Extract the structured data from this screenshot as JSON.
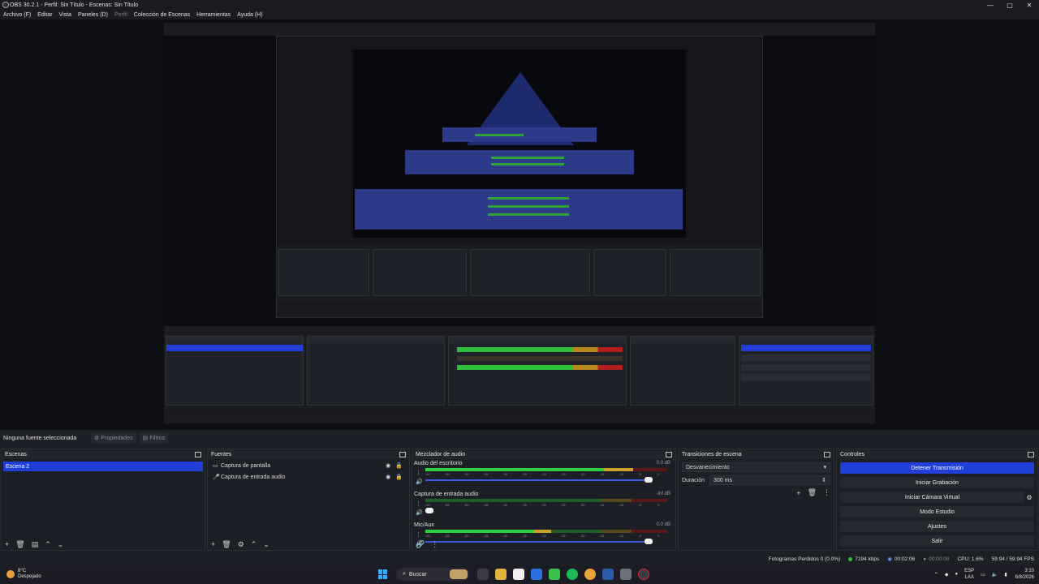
{
  "window": {
    "title": "OBS 30.2.1 - Perfil: Sin Título - Escenas: Sin Título",
    "controls": [
      "—",
      "▢",
      "✕"
    ]
  },
  "menu": {
    "items": [
      {
        "label": "Archivo (F)",
        "enabled": true
      },
      {
        "label": "Editar",
        "enabled": true
      },
      {
        "label": "Vista",
        "enabled": true
      },
      {
        "label": "Paneles (D)",
        "enabled": true
      },
      {
        "label": "Perfil",
        "enabled": false
      },
      {
        "label": "Colección de Escenas",
        "enabled": true
      },
      {
        "label": "Herramientas",
        "enabled": true
      },
      {
        "label": "Ayuda (H)",
        "enabled": true
      }
    ]
  },
  "sourcebar": {
    "no_selection": "Ninguna fuente seleccionada",
    "properties": "Propiedades",
    "filters": "Filtros"
  },
  "scenes": {
    "title": "Escenas",
    "items": [
      "Escena 2"
    ],
    "selected": "Escena 2"
  },
  "sources": {
    "title": "Fuentes",
    "items": [
      {
        "label": "Captura de pantalla",
        "icon": "monitor-icon"
      },
      {
        "label": "Captura de entrada audio",
        "icon": "microphone-icon"
      }
    ]
  },
  "mixer": {
    "title": "Mezclador de audio",
    "channels": [
      {
        "name": "Audio del escritorio",
        "db": "0.0 dB",
        "level": 0.86,
        "volume": 1.0
      },
      {
        "name": "Captura de entrada audio",
        "db": "-inf dB",
        "level": 0.0,
        "volume": 0.0
      },
      {
        "name": "Mic/Aux",
        "db": "0.0 dB",
        "level": 0.52,
        "volume": 1.0
      }
    ],
    "ticks": [
      "-60",
      "-55",
      "-50",
      "-45",
      "-40",
      "-35",
      "-30",
      "-25",
      "-20",
      "-15",
      "-10",
      "-5",
      "0"
    ]
  },
  "transitions": {
    "title": "Transiciones de escena",
    "selected": "Desvanecimiento",
    "duration_label": "Duración",
    "duration_value": "300 ms"
  },
  "controls": {
    "title": "Controles",
    "buttons": {
      "stop_stream": "Detener Transmisión",
      "start_record": "Iniciar Grabación",
      "virtual_cam": "Iniciar Cámara Virtual",
      "studio_mode": "Modo Estudio",
      "settings": "Ajustes",
      "exit": "Salir"
    }
  },
  "stats": {
    "dropped": "Fotogramas Perdidos 0 (0.0%)",
    "bitrate": "7194 kbps",
    "live_time": "00:02:06",
    "rec_time": "00:00:00",
    "cpu": "CPU: 1.6%",
    "fps": "59.94 / 59.94 FPS"
  },
  "taskbar": {
    "weather_temp": "8°C",
    "weather_desc": "Despejado",
    "search": "Buscar",
    "lang_top": "ESP",
    "lang_bottom": "LAA",
    "time": "3:10",
    "date": "6/8/2026"
  },
  "colors": {
    "accent": "#1f3fd8",
    "meter_green": "#2fcf3f",
    "meter_yellow": "#caa22a",
    "meter_red": "#b21d1d"
  }
}
